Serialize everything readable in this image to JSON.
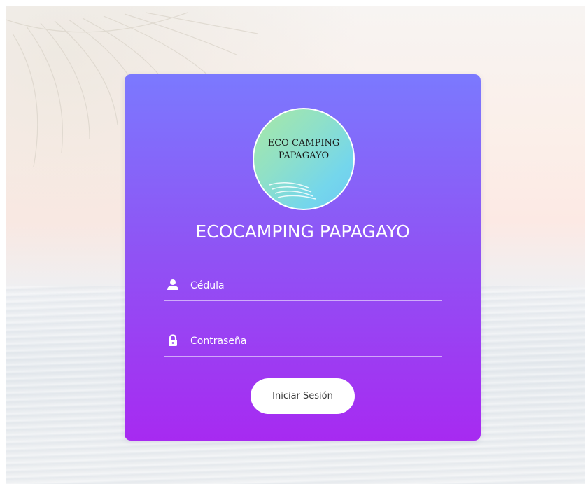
{
  "logo": {
    "line1": "ECO CAMPING",
    "line2": "PAPAGAYO"
  },
  "title": "ECOCAMPING PAPAGAYO",
  "form": {
    "cedula_placeholder": "Cédula",
    "password_placeholder": "Contraseña",
    "submit_label": "Iniciar Sesión"
  },
  "colors": {
    "card_top": "#7b79fe",
    "card_bottom": "#a72af1",
    "button_bg": "#ffffff",
    "logo_green": "#a8e8a5",
    "logo_blue": "#6fc9f2"
  },
  "icons": {
    "cedula": "user-icon",
    "password": "lock-icon"
  }
}
